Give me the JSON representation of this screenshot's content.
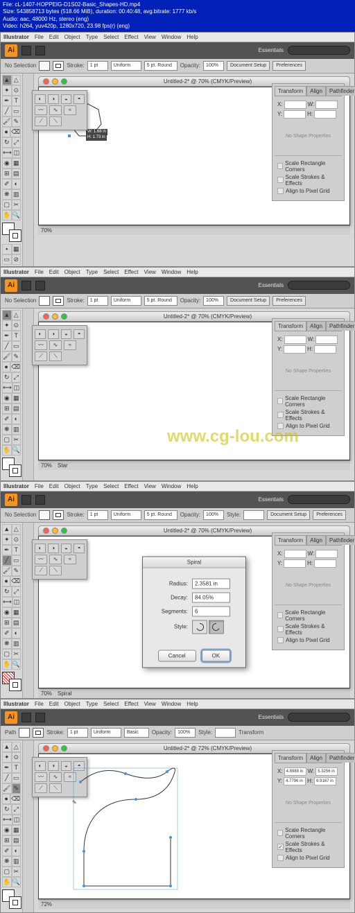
{
  "file_info": {
    "line1": "File: cL-1407-HOPPEIG-D1S02-Basic_Shapes-HD.mp4",
    "line2": "Size: 543858713 bytes (518.66 MiB), duration: 00:40:48, avg.bitrate: 1777 kb/s",
    "line3": "Audio: aac, 48000 Hz, stereo (eng)",
    "line4": "Video: h264, yuv420p, 1280x720, 23.98 fps(r) (eng)"
  },
  "watermark": "www.cg-lou.com",
  "menubar": {
    "app": "Illustrator",
    "items": [
      "File",
      "Edit",
      "Object",
      "Type",
      "Select",
      "Effect",
      "View",
      "Window",
      "Help"
    ]
  },
  "app_logo": "Ai",
  "essentials": "Essentials",
  "ctrlbar": {
    "no_selection": "No Selection",
    "path": "Path",
    "stroke_lbl": "Stroke:",
    "stroke_val": "1 pt",
    "uniform": "Uniform",
    "basic": "Basic",
    "round": "5 pt. Round",
    "opacity_lbl": "Opacity:",
    "opacity_val": "100%",
    "style_lbl": "Style:",
    "docsetup": "Document Setup",
    "prefs": "Preferences",
    "transform": "Transform"
  },
  "window": {
    "title1": "Untitled-2* @ 70% (CMYK/Preview)",
    "title4": "Untitled-2* @ 72% (CMYK/Preview)"
  },
  "dimensions": {
    "w": "W: 1.68 in",
    "h": "H: 1.73 in"
  },
  "right_panel": {
    "tabs": [
      "Transform",
      "Align",
      "Pathfinder"
    ],
    "x_lbl": "X:",
    "y_lbl": "Y:",
    "w_lbl": "W:",
    "h_lbl": "H:",
    "x4": "4.8988 in",
    "y4": "4.7796 in",
    "w4": "5.3256 in",
    "h4": "6.9167 in",
    "noprops": "No Shape Properties",
    "chk1": "Scale Rectangle Corners",
    "chk2": "Scale Strokes & Effects",
    "chk3": "Align to Pixel Grid"
  },
  "status": {
    "zoom1": "70%",
    "zoom4": "72%",
    "star": "Star",
    "spiral": "Spiral"
  },
  "dialog": {
    "title": "Spiral",
    "radius_lbl": "Radius:",
    "radius_val": "2.3581 in",
    "decay_lbl": "Decay:",
    "decay_val": "84.05%",
    "segments_lbl": "Segments:",
    "segments_val": "6",
    "style_lbl": "Style:",
    "cancel": "Cancel",
    "ok": "OK"
  }
}
